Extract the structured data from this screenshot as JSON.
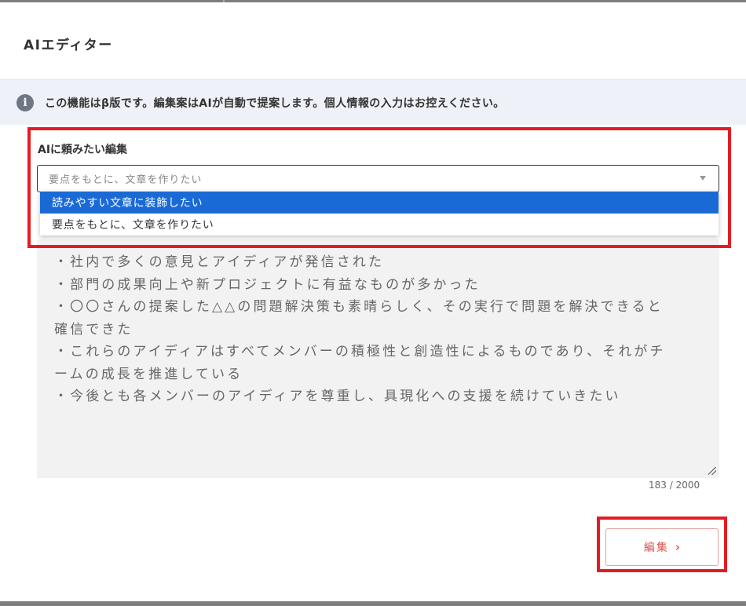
{
  "dialog": {
    "title": "AIエディター"
  },
  "info": {
    "icon": "info-icon",
    "glyph": "i",
    "text": "この機能はβ版です。編集案はAIが自動で提案します。個人情報の入力はお控えください。"
  },
  "request": {
    "label": "AIに頼みたい編集",
    "selected_value": "要点をもとに、文章を作りたい",
    "options": [
      {
        "label": "読みやすい文章に装飾したい",
        "highlighted": true
      },
      {
        "label": "要点をもとに、文章を作りたい",
        "highlighted": false
      }
    ]
  },
  "editor": {
    "lines": [
      "・社内で多くの意見とアイディアが発信された",
      "・部門の成果向上や新プロジェクトに有益なものが多かった",
      "・〇〇さんの提案した△△の問題解決策も素晴らしく、その実行で問題を解決できると",
      "確信できた",
      "・これらのアイディアはすべてメンバーの積極性と創造性によるものであり、それがチ",
      "ームの成長を推進している",
      "・今後とも各メンバーのアイディアを尊重し、具現化への支援を続けていきたい"
    ],
    "char_count": "183 / 2000"
  },
  "actions": {
    "edit_label": "編集",
    "edit_chevron": "›"
  },
  "colors": {
    "highlight_border": "#e31c24",
    "selected_option": "#1a6ad6",
    "button_text": "#d9534f"
  }
}
